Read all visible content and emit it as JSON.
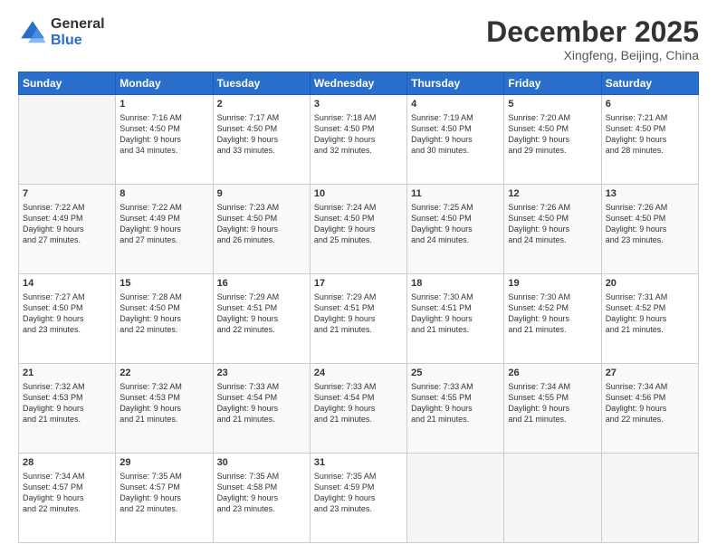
{
  "logo": {
    "general": "General",
    "blue": "Blue"
  },
  "header": {
    "month": "December 2025",
    "location": "Xingfeng, Beijing, China"
  },
  "days_of_week": [
    "Sunday",
    "Monday",
    "Tuesday",
    "Wednesday",
    "Thursday",
    "Friday",
    "Saturday"
  ],
  "weeks": [
    [
      {
        "num": "",
        "info": ""
      },
      {
        "num": "1",
        "info": "Sunrise: 7:16 AM\nSunset: 4:50 PM\nDaylight: 9 hours\nand 34 minutes."
      },
      {
        "num": "2",
        "info": "Sunrise: 7:17 AM\nSunset: 4:50 PM\nDaylight: 9 hours\nand 33 minutes."
      },
      {
        "num": "3",
        "info": "Sunrise: 7:18 AM\nSunset: 4:50 PM\nDaylight: 9 hours\nand 32 minutes."
      },
      {
        "num": "4",
        "info": "Sunrise: 7:19 AM\nSunset: 4:50 PM\nDaylight: 9 hours\nand 30 minutes."
      },
      {
        "num": "5",
        "info": "Sunrise: 7:20 AM\nSunset: 4:50 PM\nDaylight: 9 hours\nand 29 minutes."
      },
      {
        "num": "6",
        "info": "Sunrise: 7:21 AM\nSunset: 4:50 PM\nDaylight: 9 hours\nand 28 minutes."
      }
    ],
    [
      {
        "num": "7",
        "info": "Sunrise: 7:22 AM\nSunset: 4:49 PM\nDaylight: 9 hours\nand 27 minutes."
      },
      {
        "num": "8",
        "info": "Sunrise: 7:22 AM\nSunset: 4:49 PM\nDaylight: 9 hours\nand 27 minutes."
      },
      {
        "num": "9",
        "info": "Sunrise: 7:23 AM\nSunset: 4:50 PM\nDaylight: 9 hours\nand 26 minutes."
      },
      {
        "num": "10",
        "info": "Sunrise: 7:24 AM\nSunset: 4:50 PM\nDaylight: 9 hours\nand 25 minutes."
      },
      {
        "num": "11",
        "info": "Sunrise: 7:25 AM\nSunset: 4:50 PM\nDaylight: 9 hours\nand 24 minutes."
      },
      {
        "num": "12",
        "info": "Sunrise: 7:26 AM\nSunset: 4:50 PM\nDaylight: 9 hours\nand 24 minutes."
      },
      {
        "num": "13",
        "info": "Sunrise: 7:26 AM\nSunset: 4:50 PM\nDaylight: 9 hours\nand 23 minutes."
      }
    ],
    [
      {
        "num": "14",
        "info": "Sunrise: 7:27 AM\nSunset: 4:50 PM\nDaylight: 9 hours\nand 23 minutes."
      },
      {
        "num": "15",
        "info": "Sunrise: 7:28 AM\nSunset: 4:50 PM\nDaylight: 9 hours\nand 22 minutes."
      },
      {
        "num": "16",
        "info": "Sunrise: 7:29 AM\nSunset: 4:51 PM\nDaylight: 9 hours\nand 22 minutes."
      },
      {
        "num": "17",
        "info": "Sunrise: 7:29 AM\nSunset: 4:51 PM\nDaylight: 9 hours\nand 21 minutes."
      },
      {
        "num": "18",
        "info": "Sunrise: 7:30 AM\nSunset: 4:51 PM\nDaylight: 9 hours\nand 21 minutes."
      },
      {
        "num": "19",
        "info": "Sunrise: 7:30 AM\nSunset: 4:52 PM\nDaylight: 9 hours\nand 21 minutes."
      },
      {
        "num": "20",
        "info": "Sunrise: 7:31 AM\nSunset: 4:52 PM\nDaylight: 9 hours\nand 21 minutes."
      }
    ],
    [
      {
        "num": "21",
        "info": "Sunrise: 7:32 AM\nSunset: 4:53 PM\nDaylight: 9 hours\nand 21 minutes."
      },
      {
        "num": "22",
        "info": "Sunrise: 7:32 AM\nSunset: 4:53 PM\nDaylight: 9 hours\nand 21 minutes."
      },
      {
        "num": "23",
        "info": "Sunrise: 7:33 AM\nSunset: 4:54 PM\nDaylight: 9 hours\nand 21 minutes."
      },
      {
        "num": "24",
        "info": "Sunrise: 7:33 AM\nSunset: 4:54 PM\nDaylight: 9 hours\nand 21 minutes."
      },
      {
        "num": "25",
        "info": "Sunrise: 7:33 AM\nSunset: 4:55 PM\nDaylight: 9 hours\nand 21 minutes."
      },
      {
        "num": "26",
        "info": "Sunrise: 7:34 AM\nSunset: 4:55 PM\nDaylight: 9 hours\nand 21 minutes."
      },
      {
        "num": "27",
        "info": "Sunrise: 7:34 AM\nSunset: 4:56 PM\nDaylight: 9 hours\nand 22 minutes."
      }
    ],
    [
      {
        "num": "28",
        "info": "Sunrise: 7:34 AM\nSunset: 4:57 PM\nDaylight: 9 hours\nand 22 minutes."
      },
      {
        "num": "29",
        "info": "Sunrise: 7:35 AM\nSunset: 4:57 PM\nDaylight: 9 hours\nand 22 minutes."
      },
      {
        "num": "30",
        "info": "Sunrise: 7:35 AM\nSunset: 4:58 PM\nDaylight: 9 hours\nand 23 minutes."
      },
      {
        "num": "31",
        "info": "Sunrise: 7:35 AM\nSunset: 4:59 PM\nDaylight: 9 hours\nand 23 minutes."
      },
      {
        "num": "",
        "info": ""
      },
      {
        "num": "",
        "info": ""
      },
      {
        "num": "",
        "info": ""
      }
    ]
  ]
}
